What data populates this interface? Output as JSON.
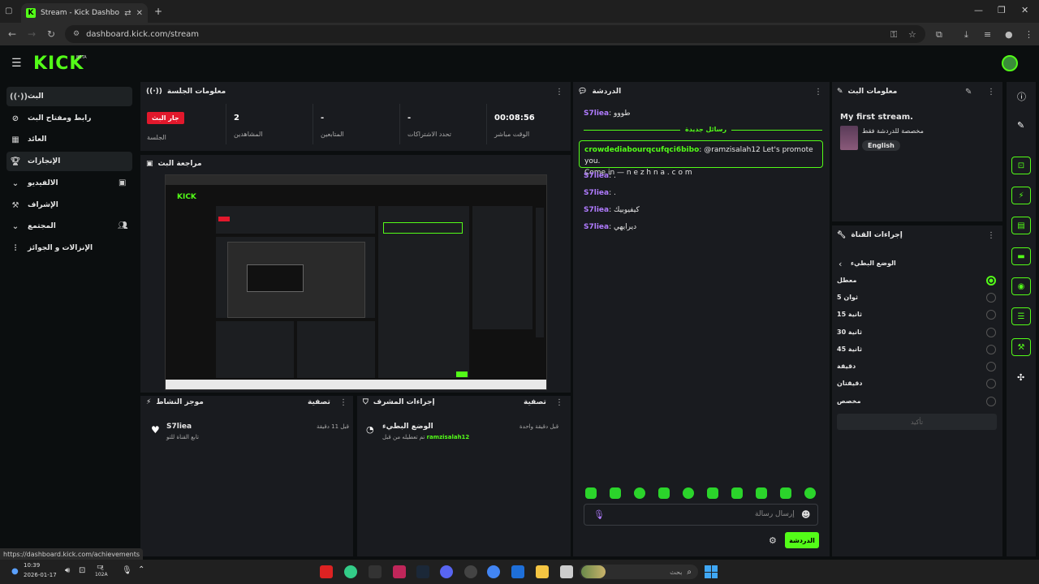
{
  "browser": {
    "tab_title": "Stream - Kick Dashboard",
    "url": "dashboard.kick.com/stream",
    "status_url": "https://dashboard.kick.com/achievements"
  },
  "brand": {
    "logo": "KICK",
    "beta": "BETA",
    "accent": "#53fc18",
    "live_color": "#e2182c"
  },
  "sidebar": {
    "items": [
      {
        "label": "البث",
        "icon": "broadcast-icon"
      },
      {
        "label": "رابط ومفتاح البث",
        "icon": "link-icon"
      },
      {
        "label": "العائد",
        "icon": "revenue-icon"
      },
      {
        "label": "الإنجازات",
        "icon": "trophy-icon"
      },
      {
        "label": "الالفيديو",
        "icon": "video-icon"
      },
      {
        "label": "الإشراف",
        "icon": "moderation-icon"
      },
      {
        "label": "المجتمع",
        "icon": "community-icon"
      },
      {
        "label": "الإنزالات و الجوائز",
        "icon": "drops-icon"
      }
    ]
  },
  "session": {
    "title": "معلومات الجلسة",
    "live_badge": "جار البث",
    "stats": [
      {
        "value": "",
        "label": "الجلسة"
      },
      {
        "value": "2",
        "label": "المشاهدين"
      },
      {
        "value": "-",
        "label": "المتابعين"
      },
      {
        "value": "-",
        "label": "تحدد الاشتراكات"
      },
      {
        "value": "00:08:56",
        "label": "الوقت مباشر"
      }
    ]
  },
  "preview": {
    "title": "مراجعة البث"
  },
  "activity": {
    "title": "موجز النشاط",
    "filter": "تصفية",
    "item_user": "S7liea",
    "item_text": "تابع القناة للتو",
    "item_time": "قبل 11 دقيقة"
  },
  "mod_actions": {
    "title": "إجراءات المشرف",
    "filter": "تصفية",
    "item_title": "الوضع البطيء",
    "item_text": "تم تعطيله من قبل",
    "item_user": "ramzisalah12",
    "item_time": "قبل دقيقة واحدة"
  },
  "chat": {
    "title": "الدردشة",
    "new_messages": "رسائل جديدة",
    "messages": [
      {
        "user": "S7liea",
        "text": "طووو"
      },
      {
        "user": "S7liea",
        "text": "."
      },
      {
        "user": "S7liea",
        "text": "."
      },
      {
        "user": "S7liea",
        "text": "كيفيوبيك"
      },
      {
        "user": "S7liea",
        "text": "ديرايهي"
      }
    ],
    "highlight": {
      "user": "crowdediabourqcufqci6bibo",
      "text": "@ramzisalah12 Let's promote you.",
      "text2": "Come in —  n e z h n a . c o m"
    },
    "input_placeholder": "إرسال رسالة",
    "send_button": "الدردشة"
  },
  "stream_info": {
    "title": "معلومات البث",
    "stream_title": "My first stream.",
    "category": "مخصصة للدردشة فقط",
    "language": "English"
  },
  "channel_actions": {
    "title": "إجراءات القناة",
    "slow_mode": "الوضع البطيء",
    "options": [
      "معطل",
      "ثوان 5",
      "ثانية 15",
      "ثانية 30",
      "ثانية 45",
      "دقيقة",
      "دقيقتان",
      "مخصص"
    ],
    "selected": 0,
    "confirm": "تأكيد"
  },
  "taskbar": {
    "time": "10:39",
    "date": "2026-01-17",
    "search_placeholder": "بحث",
    "battery_text": "102A",
    "lang": "ع"
  }
}
